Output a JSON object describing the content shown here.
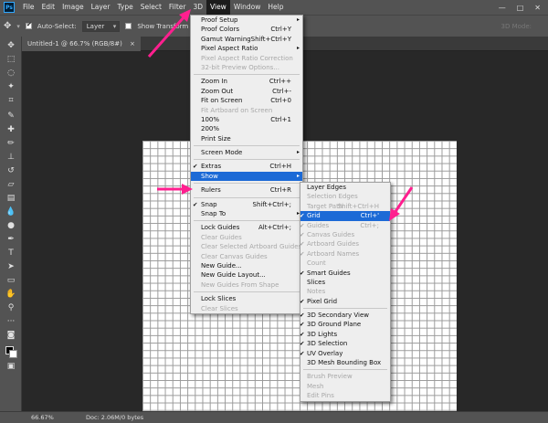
{
  "app": {
    "logo": "Ps"
  },
  "menubar": {
    "items": [
      "File",
      "Edit",
      "Image",
      "Layer",
      "Type",
      "Select",
      "Filter",
      "3D",
      "View",
      "Window",
      "Help"
    ],
    "active": "View",
    "window_controls": [
      "—",
      "□",
      "✕"
    ]
  },
  "options_bar": {
    "auto_select_label": "Auto-Select:",
    "auto_select_value": "Layer",
    "transform_label": "Show Transform Controls",
    "mode_3d": "3D Mode:"
  },
  "document": {
    "tab_title": "Untitled-1 @ 66.7% (RGB/8#)",
    "tab_close": "×"
  },
  "status": {
    "zoom": "66.67%",
    "doc": "Doc: 2.06M/0 bytes"
  },
  "tools": [
    {
      "name": "move-tool-icon",
      "glyph": "✥"
    },
    {
      "name": "marquee-tool-icon",
      "glyph": "⬚"
    },
    {
      "name": "lasso-tool-icon",
      "glyph": "◌"
    },
    {
      "name": "magic-wand-icon",
      "glyph": "✦"
    },
    {
      "name": "crop-tool-icon",
      "glyph": "⌗"
    },
    {
      "name": "eyedropper-icon",
      "glyph": "✎"
    },
    {
      "name": "healing-brush-icon",
      "glyph": "✚"
    },
    {
      "name": "brush-tool-icon",
      "glyph": "✏"
    },
    {
      "name": "clone-stamp-icon",
      "glyph": "⊥"
    },
    {
      "name": "history-brush-icon",
      "glyph": "↺"
    },
    {
      "name": "eraser-icon",
      "glyph": "▱"
    },
    {
      "name": "gradient-tool-icon",
      "glyph": "▤"
    },
    {
      "name": "blur-tool-icon",
      "glyph": "💧"
    },
    {
      "name": "dodge-tool-icon",
      "glyph": "●"
    },
    {
      "name": "pen-tool-icon",
      "glyph": "✒"
    },
    {
      "name": "type-tool-icon",
      "glyph": "T"
    },
    {
      "name": "path-selection-icon",
      "glyph": "➤"
    },
    {
      "name": "rectangle-tool-icon",
      "glyph": "▭"
    },
    {
      "name": "hand-tool-icon",
      "glyph": "✋"
    },
    {
      "name": "zoom-tool-icon",
      "glyph": "⚲"
    },
    {
      "name": "edit-toolbar-icon",
      "glyph": "···"
    },
    {
      "name": "quick-mask-icon",
      "glyph": "◙"
    },
    {
      "name": "screen-mode-icon",
      "glyph": "▣"
    }
  ],
  "view_menu": [
    {
      "label": "Proof Setup",
      "arrow": "▸"
    },
    {
      "label": "Proof Colors",
      "shortcut": "Ctrl+Y"
    },
    {
      "label": "Gamut Warning",
      "shortcut": "Shift+Ctrl+Y"
    },
    {
      "label": "Pixel Aspect Ratio",
      "arrow": "▸"
    },
    {
      "label": "Pixel Aspect Ratio Correction",
      "disabled": true
    },
    {
      "label": "32-bit Preview Options...",
      "disabled": true
    },
    {
      "sep": true
    },
    {
      "label": "Zoom In",
      "shortcut": "Ctrl++"
    },
    {
      "label": "Zoom Out",
      "shortcut": "Ctrl+-"
    },
    {
      "label": "Fit on Screen",
      "shortcut": "Ctrl+0"
    },
    {
      "label": "Fit Artboard on Screen",
      "disabled": true
    },
    {
      "label": "100%",
      "shortcut": "Ctrl+1"
    },
    {
      "label": "200%"
    },
    {
      "label": "Print Size"
    },
    {
      "sep": true
    },
    {
      "label": "Screen Mode",
      "arrow": "▸"
    },
    {
      "sep": true
    },
    {
      "label": "Extras",
      "shortcut": "Ctrl+H",
      "checked": true
    },
    {
      "label": "Show",
      "arrow": "▸",
      "highlighted": true
    },
    {
      "sep": true
    },
    {
      "label": "Rulers",
      "shortcut": "Ctrl+R"
    },
    {
      "sep": true
    },
    {
      "label": "Snap",
      "shortcut": "Shift+Ctrl+;",
      "checked": true
    },
    {
      "label": "Snap To",
      "arrow": "▸"
    },
    {
      "sep": true
    },
    {
      "label": "Lock Guides",
      "shortcut": "Alt+Ctrl+;"
    },
    {
      "label": "Clear Guides",
      "disabled": true
    },
    {
      "label": "Clear Selected Artboard Guides",
      "disabled": true
    },
    {
      "label": "Clear Canvas Guides",
      "disabled": true
    },
    {
      "label": "New Guide..."
    },
    {
      "label": "New Guide Layout..."
    },
    {
      "label": "New Guides From Shape",
      "disabled": true
    },
    {
      "sep": true
    },
    {
      "label": "Lock Slices"
    },
    {
      "label": "Clear Slices",
      "disabled": true
    }
  ],
  "show_menu": [
    {
      "label": "Layer Edges"
    },
    {
      "label": "Selection Edges",
      "disabled": true
    },
    {
      "label": "Target Path",
      "shortcut": "Shift+Ctrl+H",
      "disabled": true
    },
    {
      "label": "Grid",
      "shortcut": "Ctrl+'",
      "checked": true,
      "highlighted": true
    },
    {
      "label": "Guides",
      "shortcut": "Ctrl+;",
      "checked": true,
      "disabled": true
    },
    {
      "label": "Canvas Guides",
      "checked": true,
      "disabled": true
    },
    {
      "label": "Artboard Guides",
      "checked": true,
      "disabled": true
    },
    {
      "label": "Artboard Names",
      "checked": true,
      "disabled": true
    },
    {
      "label": "Count",
      "disabled": true
    },
    {
      "label": "Smart Guides",
      "checked": true
    },
    {
      "label": "Slices"
    },
    {
      "label": "Notes",
      "disabled": true
    },
    {
      "label": "Pixel Grid",
      "checked": true
    },
    {
      "sep": true
    },
    {
      "label": "3D Secondary View",
      "checked": true
    },
    {
      "label": "3D Ground Plane",
      "checked": true
    },
    {
      "label": "3D Lights",
      "checked": true
    },
    {
      "label": "3D Selection",
      "checked": true
    },
    {
      "label": "UV Overlay",
      "checked": true
    },
    {
      "label": "3D Mesh Bounding Box"
    },
    {
      "sep": true
    },
    {
      "label": "Brush Preview",
      "disabled": true
    },
    {
      "label": "Mesh",
      "disabled": true
    },
    {
      "label": "Edit Pins",
      "disabled": true
    }
  ],
  "colors": {
    "annotation_arrow": "#ff1f8f",
    "menu_highlight": "#1c6ad6"
  }
}
